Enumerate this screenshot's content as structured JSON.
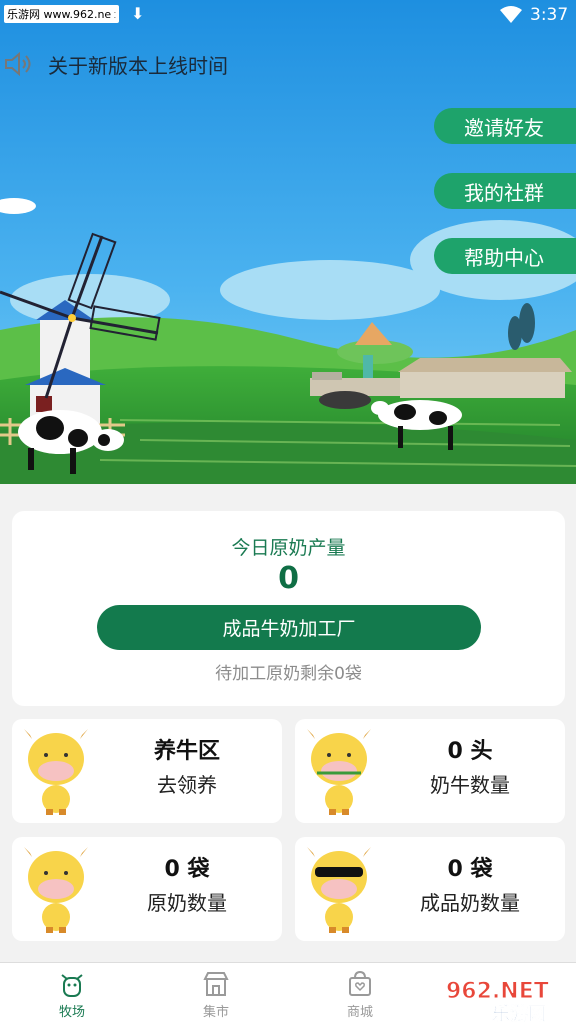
{
  "status_bar": {
    "watermark": "乐游网 www.962.net",
    "time": "3:37"
  },
  "notice": {
    "text": "关于新版本上线时间"
  },
  "side_buttons": {
    "invite": "邀请好友",
    "community": "我的社群",
    "help": "帮助中心"
  },
  "production": {
    "title": "今日原奶产量",
    "value": "0",
    "factory_button": "成品牛奶加工厂",
    "pending": "待加工原奶剩余0袋"
  },
  "tiles": [
    {
      "line1": "养牛区",
      "line2": "去领养"
    },
    {
      "line1": "0 头",
      "line2": "奶牛数量"
    },
    {
      "line1": "0 袋",
      "line2": "原奶数量"
    },
    {
      "line1": "0 袋",
      "line2": "成品奶数量"
    }
  ],
  "tabs": [
    {
      "label": "牧场",
      "active": true
    },
    {
      "label": "集市",
      "active": false
    },
    {
      "label": "商城",
      "active": false
    }
  ],
  "colors": {
    "primary_green": "#137a4d",
    "active_tab": "#1a7a52",
    "inactive_tab": "#9a9a9a",
    "sky": "#2d9be8"
  },
  "watermark_962": {
    "logo": "962.NET",
    "text": "乐游网"
  }
}
